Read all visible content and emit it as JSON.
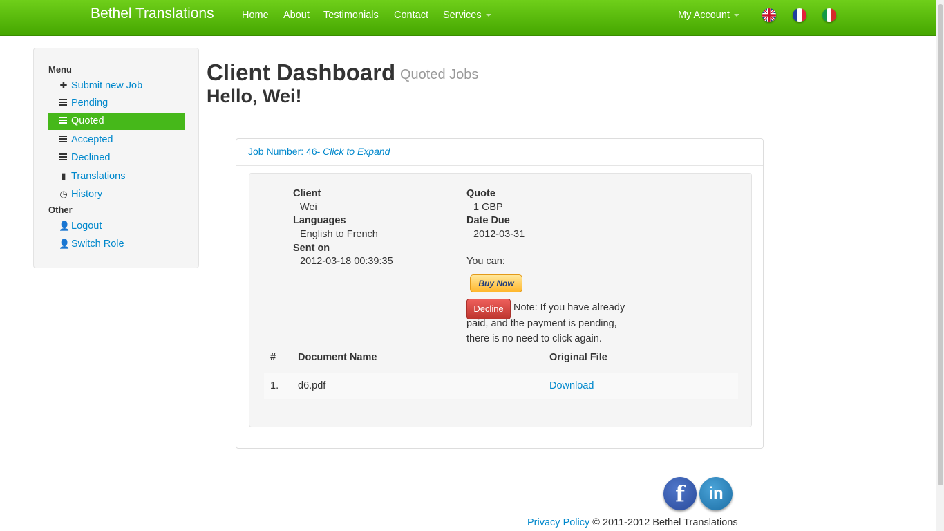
{
  "navbar": {
    "brand": "Bethel Translations",
    "links": [
      "Home",
      "About",
      "Testimonials",
      "Contact",
      "Services"
    ],
    "account": "My Account"
  },
  "sidebar": {
    "menu_header": "Menu",
    "menu_items": [
      {
        "label": "Submit new Job",
        "icon": "plus-icon"
      },
      {
        "label": "Pending",
        "icon": "list-icon"
      },
      {
        "label": "Quoted",
        "icon": "list-icon",
        "active": true
      },
      {
        "label": "Accepted",
        "icon": "list-icon"
      },
      {
        "label": "Declined",
        "icon": "list-icon"
      },
      {
        "label": "Translations",
        "icon": "file-icon"
      },
      {
        "label": "History",
        "icon": "clock-icon"
      }
    ],
    "other_header": "Other",
    "other_items": [
      {
        "label": "Logout",
        "icon": "user-icon"
      },
      {
        "label": "Switch Role",
        "icon": "user-icon"
      }
    ]
  },
  "page": {
    "title": "Client Dashboard",
    "subtitle": "Quoted Jobs",
    "greeting": "Hello, Wei!"
  },
  "job": {
    "header_prefix": "Job Number: 46- ",
    "header_action": "Click to Expand",
    "client_label": "Client",
    "client": "Wei",
    "languages_label": "Languages",
    "languages": "English to French",
    "sent_label": "Sent on",
    "sent": "2012-03-18 00:39:35",
    "quote_label": "Quote",
    "quote": "1 GBP",
    "due_label": "Date Due",
    "due": "2012-03-31",
    "you_can": "You can:",
    "buy_now": "Buy Now",
    "decline": "Decline",
    "note": "Note: If you have already paid, and the payment is pending, there is no need to click again.",
    "table": {
      "headers": [
        "#",
        "Document Name",
        "Original File"
      ],
      "rows": [
        {
          "num": "1.",
          "name": "d6.pdf",
          "file": "Download"
        }
      ]
    }
  },
  "footer": {
    "privacy": "Privacy Policy",
    "copyright": "© 2011-2012 Bethel Translations"
  },
  "colors": {
    "nav_green": "#45a600",
    "active_green": "#46b81a",
    "link_blue": "#0088cc",
    "decline_red": "#bd362f"
  }
}
